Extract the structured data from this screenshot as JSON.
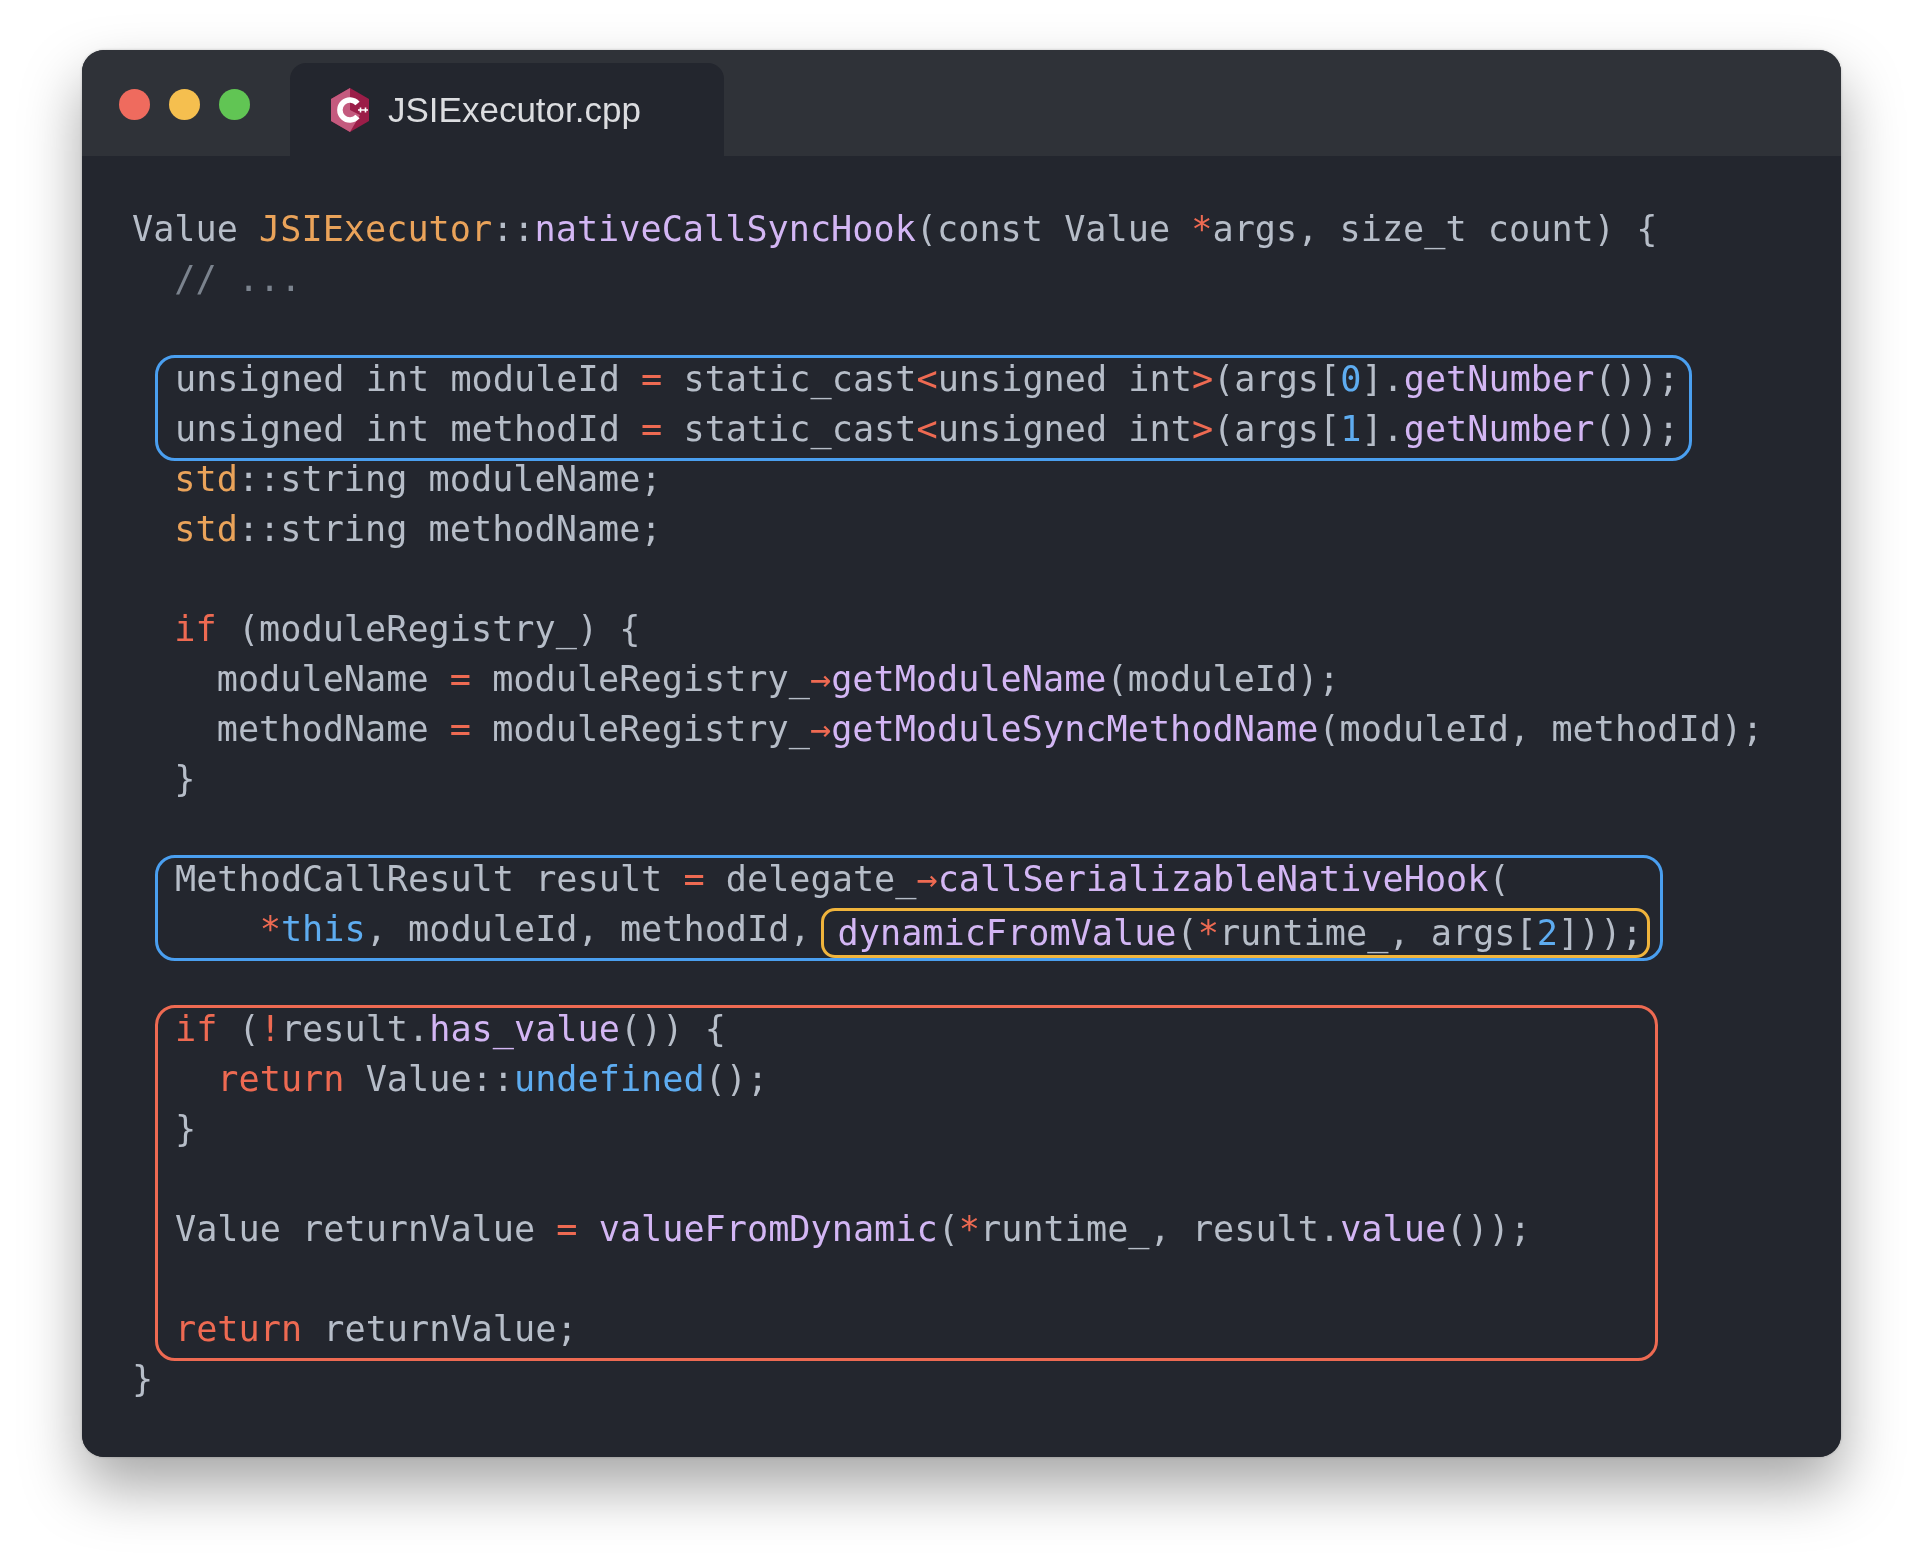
{
  "tab": {
    "title": "JSIExecutor.cpp",
    "selected": true
  },
  "code": {
    "sections": [
      {
        "lines": [
          {
            "kind": "code",
            "tokens": [
              {
                "kind": "plain",
                "text": "Value "
              },
              {
                "kind": "type",
                "text": "JSIExecutor"
              },
              {
                "kind": "plain",
                "text": "::"
              },
              {
                "kind": "fn",
                "text": "nativeCallSyncHook"
              },
              {
                "kind": "plain",
                "text": "(const Value "
              },
              {
                "kind": "op",
                "text": "*"
              },
              {
                "kind": "plain",
                "text": "args, size_t count) {"
              }
            ]
          },
          {
            "kind": "code",
            "tokens": [
              {
                "kind": "comment",
                "text": "  // ..."
              }
            ]
          },
          {
            "kind": "blank"
          }
        ]
      },
      {
        "color": "#4a9ff0",
        "lines": [
          {
            "kind": "code",
            "tokens": [
              {
                "kind": "plain",
                "text": "unsigned int moduleId "
              },
              {
                "kind": "op",
                "text": "="
              },
              {
                "kind": "plain",
                "text": " static_cast"
              },
              {
                "kind": "op",
                "text": "<"
              },
              {
                "kind": "plain",
                "text": "unsigned int"
              },
              {
                "kind": "op",
                "text": ">"
              },
              {
                "kind": "plain",
                "text": "(args["
              },
              {
                "kind": "num",
                "text": "0"
              },
              {
                "kind": "plain",
                "text": "]."
              },
              {
                "kind": "fn",
                "text": "getNumber"
              },
              {
                "kind": "plain",
                "text": "());"
              }
            ]
          },
          {
            "kind": "code",
            "tokens": [
              {
                "kind": "plain",
                "text": "unsigned int methodId "
              },
              {
                "kind": "op",
                "text": "="
              },
              {
                "kind": "plain",
                "text": " static_cast"
              },
              {
                "kind": "op",
                "text": "<"
              },
              {
                "kind": "plain",
                "text": "unsigned int"
              },
              {
                "kind": "op",
                "text": ">"
              },
              {
                "kind": "plain",
                "text": "(args["
              },
              {
                "kind": "num",
                "text": "1"
              },
              {
                "kind": "plain",
                "text": "]."
              },
              {
                "kind": "fn",
                "text": "getNumber"
              },
              {
                "kind": "plain",
                "text": "());"
              }
            ]
          }
        ]
      },
      {
        "lines": [
          {
            "kind": "code",
            "tokens": [
              {
                "kind": "type",
                "text": "  std"
              },
              {
                "kind": "plain",
                "text": "::string moduleName;"
              }
            ]
          },
          {
            "kind": "code",
            "tokens": [
              {
                "kind": "type",
                "text": "  std"
              },
              {
                "kind": "plain",
                "text": "::string methodName;"
              }
            ]
          },
          {
            "kind": "blank"
          },
          {
            "kind": "code",
            "tokens": [
              {
                "kind": "op",
                "text": "  if"
              },
              {
                "kind": "plain",
                "text": " (moduleRegistry_) {"
              }
            ]
          },
          {
            "kind": "code",
            "tokens": [
              {
                "kind": "plain",
                "text": "    moduleName "
              },
              {
                "kind": "op",
                "text": "="
              },
              {
                "kind": "plain",
                "text": " moduleRegistry_"
              },
              {
                "kind": "op",
                "text": "→"
              },
              {
                "kind": "fn",
                "text": "getModuleName"
              },
              {
                "kind": "plain",
                "text": "(moduleId);"
              }
            ]
          },
          {
            "kind": "code",
            "tokens": [
              {
                "kind": "plain",
                "text": "    methodName "
              },
              {
                "kind": "op",
                "text": "="
              },
              {
                "kind": "plain",
                "text": " moduleRegistry_"
              },
              {
                "kind": "op",
                "text": "→"
              },
              {
                "kind": "fn",
                "text": "getModuleSyncMethodName"
              },
              {
                "kind": "plain",
                "text": "(moduleId, methodId);"
              }
            ]
          },
          {
            "kind": "code",
            "tokens": [
              {
                "kind": "plain",
                "text": "  }"
              }
            ]
          },
          {
            "kind": "blank"
          }
        ]
      },
      {
        "color": "#4a9ff0",
        "lines": [
          {
            "kind": "code",
            "tokens": [
              {
                "kind": "plain",
                "text": "MethodCallResult result "
              },
              {
                "kind": "op",
                "text": "="
              },
              {
                "kind": "plain",
                "text": " delegate_"
              },
              {
                "kind": "op",
                "text": "→"
              },
              {
                "kind": "fn",
                "text": "callSerializableNativeHook"
              },
              {
                "kind": "plain",
                "text": "("
              }
            ]
          },
          {
            "kind": "code",
            "tokens": [
              {
                "kind": "op",
                "text": "    *"
              },
              {
                "kind": "num",
                "text": "this"
              },
              {
                "kind": "plain",
                "text": ", moduleId, methodId,"
              },
              {
                "kind": "frame",
                "color": "#f0b43c",
                "tokens": [
                  {
                    "kind": "fn",
                    "text": "dynamicFromValue"
                  },
                  {
                    "kind": "plain",
                    "text": "("
                  },
                  {
                    "kind": "op",
                    "text": "*"
                  },
                  {
                    "kind": "plain",
                    "text": "runtime_, args["
                  },
                  {
                    "kind": "num",
                    "text": "2"
                  },
                  {
                    "kind": "plain",
                    "text": "]));"
                  }
                ]
              }
            ]
          }
        ]
      },
      {
        "lines": [
          {
            "kind": "blank"
          }
        ]
      },
      {
        "color": "#ee6a52",
        "lines": [
          {
            "kind": "code",
            "tokens": [
              {
                "kind": "op",
                "text": "if"
              },
              {
                "kind": "plain",
                "text": " ("
              },
              {
                "kind": "op",
                "text": "!"
              },
              {
                "kind": "plain",
                "text": "result."
              },
              {
                "kind": "fn",
                "text": "has_value"
              },
              {
                "kind": "plain",
                "text": "()) {"
              }
            ]
          },
          {
            "kind": "code",
            "tokens": [
              {
                "kind": "op",
                "text": "  return"
              },
              {
                "kind": "plain",
                "text": " Value::"
              },
              {
                "kind": "num",
                "text": "undefined"
              },
              {
                "kind": "plain",
                "text": "();"
              }
            ]
          },
          {
            "kind": "code",
            "tokens": [
              {
                "kind": "plain",
                "text": "}"
              }
            ]
          },
          {
            "kind": "blank"
          },
          {
            "kind": "code",
            "tokens": [
              {
                "kind": "plain",
                "text": "Value returnValue "
              },
              {
                "kind": "op",
                "text": "="
              },
              {
                "kind": "fn",
                "text": " valueFromDynamic"
              },
              {
                "kind": "plain",
                "text": "("
              },
              {
                "kind": "op",
                "text": "*"
              },
              {
                "kind": "plain",
                "text": "runtime_, result."
              },
              {
                "kind": "fn",
                "text": "value"
              },
              {
                "kind": "plain",
                "text": "());"
              }
            ]
          },
          {
            "kind": "blank"
          },
          {
            "kind": "code",
            "tokens": [
              {
                "kind": "op",
                "text": "return"
              },
              {
                "kind": "plain",
                "text": " returnValue;"
              }
            ]
          }
        ]
      },
      {
        "lines": [
          {
            "kind": "code",
            "tokens": [
              {
                "kind": "plain",
                "text": "}"
              }
            ]
          }
        ]
      }
    ]
  }
}
